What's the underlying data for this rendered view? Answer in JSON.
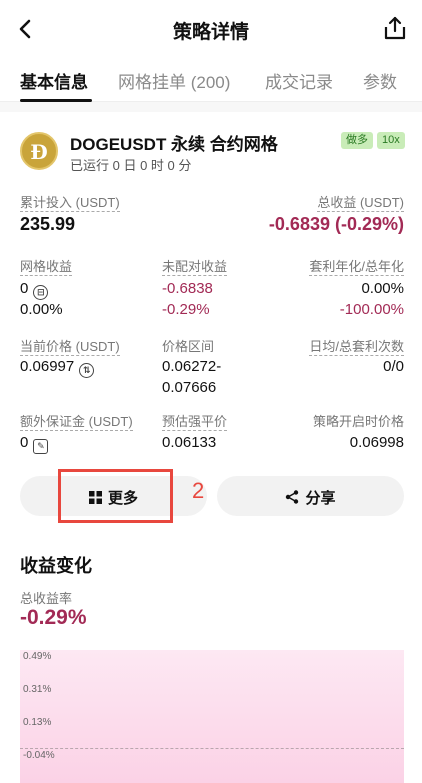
{
  "header": {
    "title": "策略详情",
    "back_icon": "chevron-left-icon",
    "share_icon": "share-upload-icon"
  },
  "tabs": [
    {
      "label": "基本信息",
      "active": true
    },
    {
      "label": "网格挂单 (200)",
      "active": false
    },
    {
      "label": "成交记录",
      "active": false
    },
    {
      "label": "参数",
      "active": false
    }
  ],
  "strategy": {
    "name": "DOGEUSDT 永续 合约网格",
    "run_time": "已运行 0 日 0 时 0 分",
    "badges": [
      "做多",
      "10x"
    ],
    "coin_icon": "dogecoin-logo"
  },
  "summary": {
    "invested_label": "累计投入 (USDT)",
    "invested_value": "235.99",
    "total_profit_label": "总收益 (USDT)",
    "total_profit_value": "-0.6839 (-0.29%)"
  },
  "stats": {
    "grid_profit_label": "网格收益",
    "grid_profit_value": "0",
    "grid_profit_pct": "0.00%",
    "unmatched_label": "未配对收益",
    "unmatched_value": "-0.6838",
    "unmatched_pct": "-0.29%",
    "apr_label": "套利年化/总年化",
    "apr_value": "0.00%",
    "total_apr_value": "-100.00%",
    "price_label": "当前价格 (USDT)",
    "price_value": "0.06997",
    "range_label": "价格区间",
    "range_low": "0.06272-",
    "range_high": "0.07666",
    "arb_count_label": "日均/总套利次数",
    "arb_count_value": "0/0",
    "margin_label": "额外保证金 (USDT)",
    "margin_value": "0",
    "liq_label": "预估强平价",
    "liq_value": "0.06133",
    "start_price_label": "策略开启时价格",
    "start_price_value": "0.06998"
  },
  "buttons": {
    "more_label": "更多",
    "share_label": "分享"
  },
  "annotation": {
    "number": "2"
  },
  "profit_chart": {
    "title": "收益变化",
    "rate_label": "总收益率",
    "rate_value": "-0.29%"
  },
  "chart_data": {
    "type": "area",
    "y_ticks": [
      "0.49%",
      "0.31%",
      "0.13%",
      "-0.04%"
    ],
    "xlabel": "",
    "ylabel": "",
    "values": []
  }
}
